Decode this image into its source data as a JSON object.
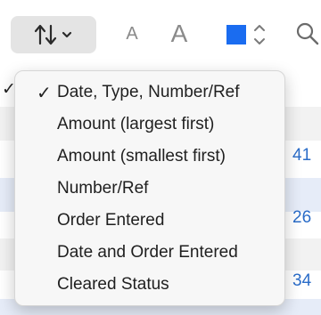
{
  "background": {
    "side_check": "✓",
    "visible_numbers": [
      "41",
      "26",
      "34"
    ]
  },
  "toolbar": {
    "sort_icon": "arrow-up-down-icon",
    "font_small_label": "A",
    "font_large_label": "A",
    "color_swatch": "#1a6cf0",
    "search_icon": "search-icon"
  },
  "sort_menu": {
    "selected_check": "✓",
    "items": [
      "Date, Type, Number/Ref",
      "Amount (largest first)",
      "Amount (smallest first)",
      "Number/Ref",
      "Order Entered",
      "Date and Order Entered",
      "Cleared Status"
    ]
  }
}
